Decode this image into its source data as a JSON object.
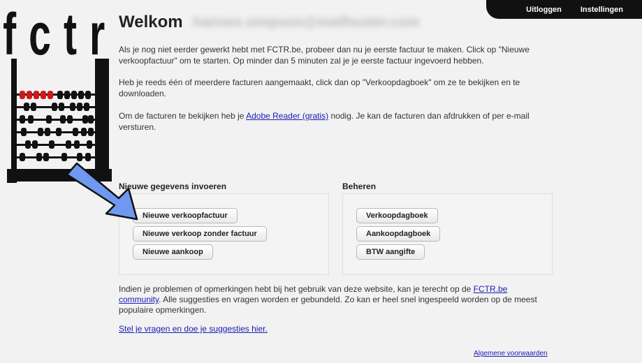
{
  "nav": {
    "logout": "Uitloggen",
    "settings": "Instellingen"
  },
  "logo": {
    "text": "fctr"
  },
  "header": {
    "welcome": "Welkom",
    "email_obscured": "hannes.simpson@mailhuster.com"
  },
  "intro": {
    "p1": "Als je nog niet eerder gewerkt hebt met FCTR.be, probeer dan nu je eerste factuur te maken. Click op \"Nieuwe verkoopfactuur\" om te starten. Op minder dan 5 minuten zal je je eerste factuur ingevoerd hebben.",
    "p2": "Heb je reeds één of meerdere facturen aangemaakt, click dan op \"Verkoopdagboek\" om ze te bekijken en te downloaden.",
    "p3_before": "Om de facturen te bekijken heb je ",
    "p3_link": "Adobe Reader (gratis)",
    "p3_after": " nodig. Je kan de facturen dan afdrukken of per e-mail versturen."
  },
  "sections": {
    "new_data": {
      "title": "Nieuwe gegevens invoeren",
      "buttons": [
        "Nieuwe verkoopfactuur",
        "Nieuwe verkoop zonder factuur",
        "Nieuwe aankoop"
      ]
    },
    "manage": {
      "title": "Beheren",
      "buttons": [
        "Verkoopdagboek",
        "Aankoopdagboek",
        "BTW aangifte"
      ]
    }
  },
  "footer": {
    "text_before": "Indien je problemen of opmerkingen hebt bij het gebruik van deze website, kan je terecht op de ",
    "community_link": "FCTR.be community",
    "text_after": ". Alle suggesties en vragen worden er gebundeld. Zo kan er heel snel ingespeeld worden op de meest populaire opmerkingen.",
    "questions_link": "Stel je vragen en doe je suggesties hier.",
    "terms_link": "Algemene voorwaarden"
  },
  "colors": {
    "arrow": "#6f98f0",
    "link": "#1a1ab4",
    "nav_bg": "#111111",
    "abacus_red": "#d01818"
  }
}
